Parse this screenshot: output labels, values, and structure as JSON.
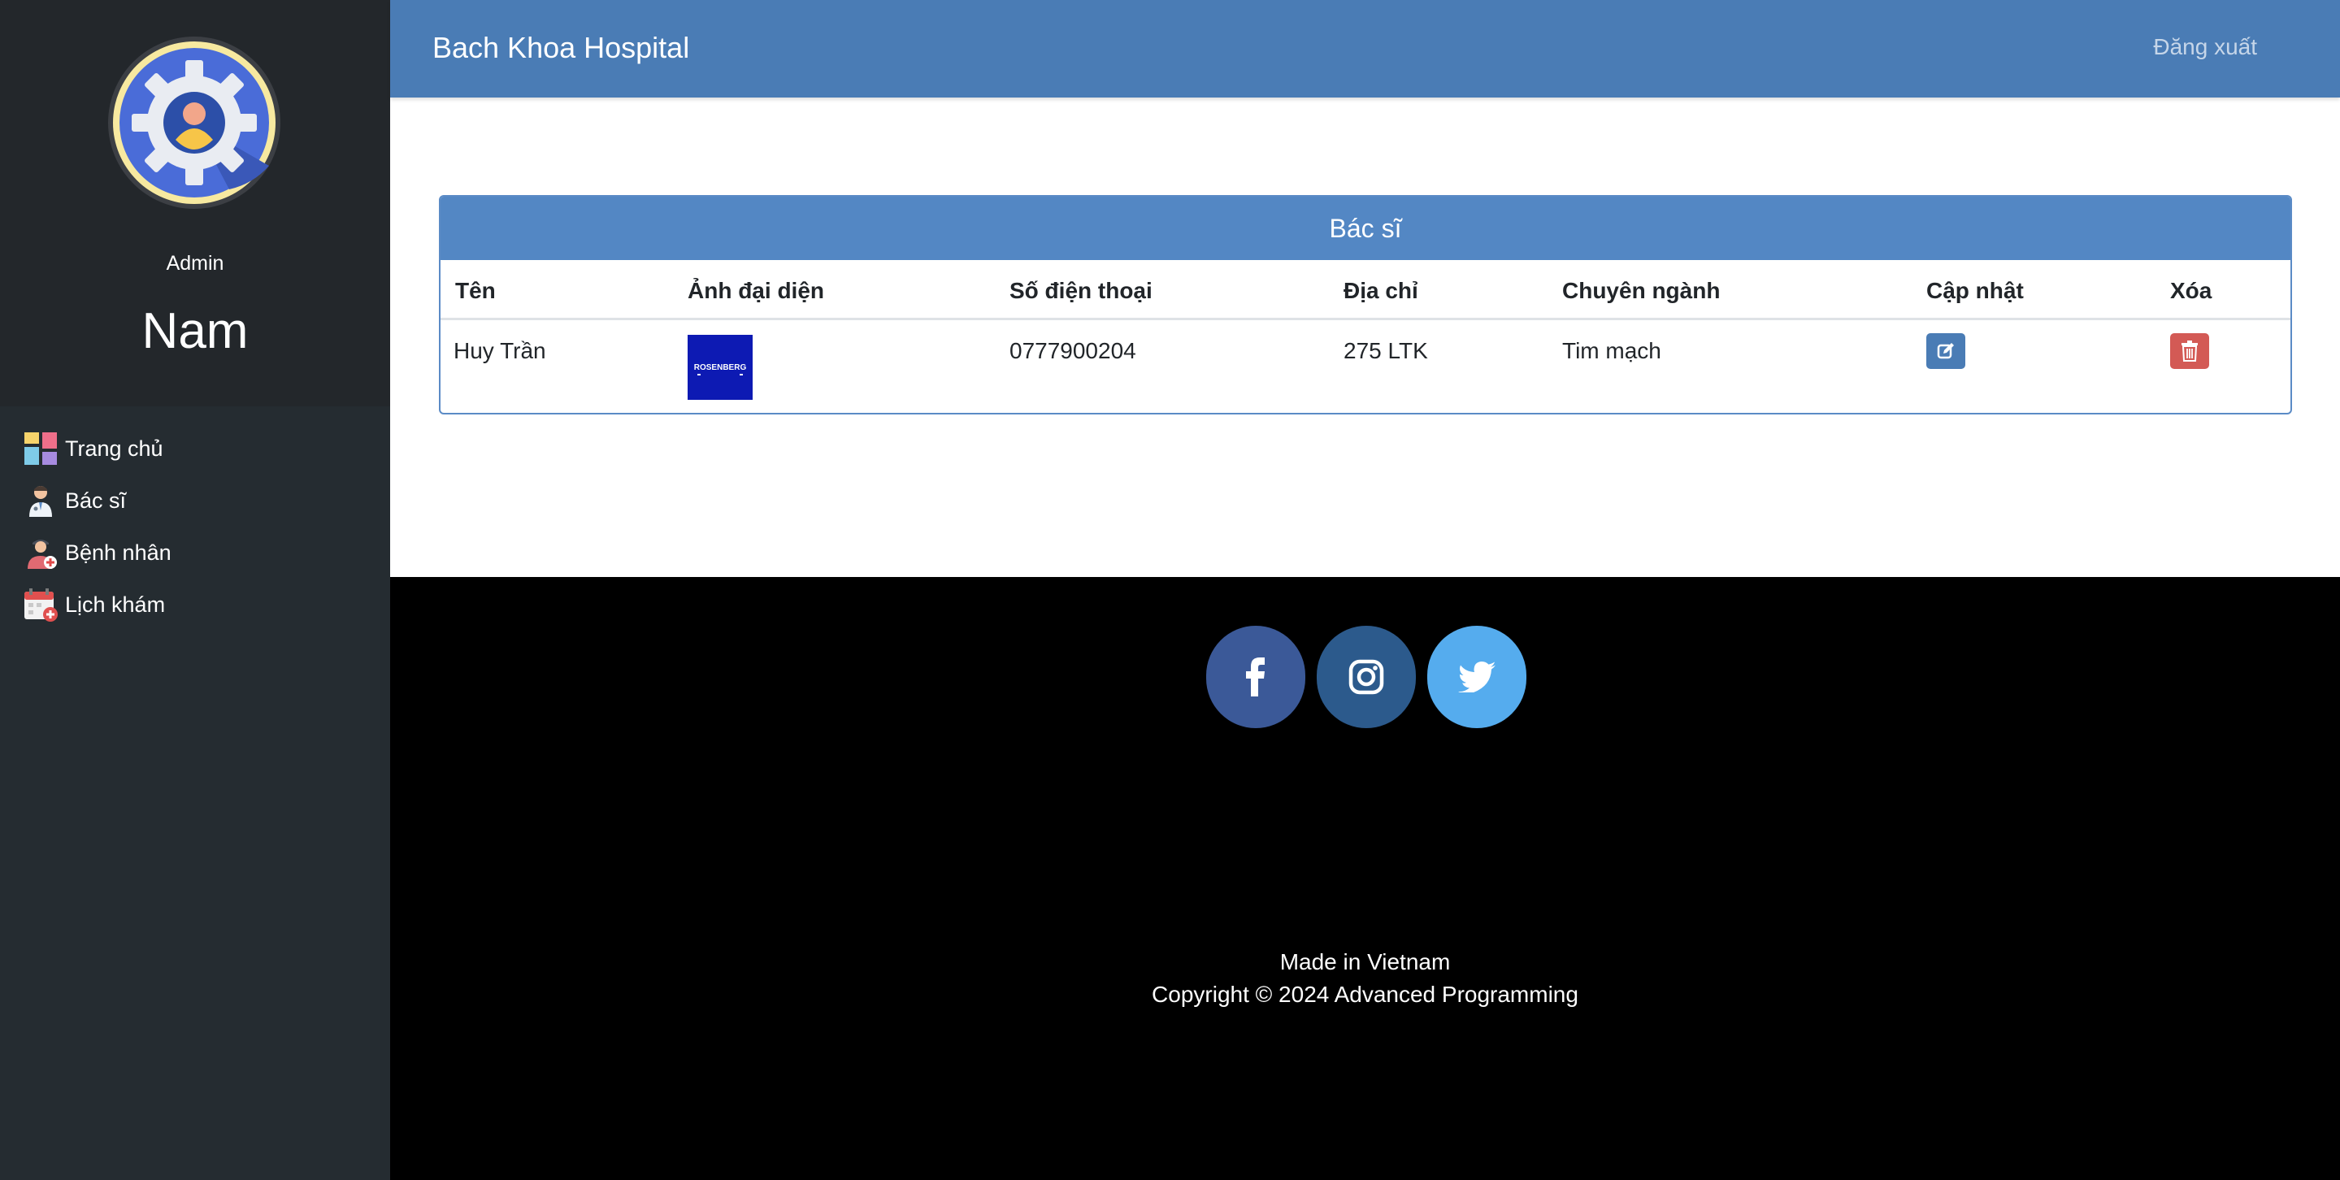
{
  "sidebar": {
    "role": "Admin",
    "user_name": "Nam",
    "items": [
      {
        "label": "Trang chủ",
        "icon": "dashboard-icon"
      },
      {
        "label": "Bác sĩ",
        "icon": "doctor-icon"
      },
      {
        "label": "Bệnh nhân",
        "icon": "patient-icon"
      },
      {
        "label": "Lịch khám",
        "icon": "calendar-icon"
      }
    ]
  },
  "header": {
    "brand": "Bach Khoa Hospital",
    "logout": "Đăng xuất"
  },
  "table": {
    "title": "Bác sĩ",
    "columns": [
      "Tên",
      "Ảnh đại diện",
      "Số điện thoại",
      "Địa chỉ",
      "Chuyên ngành",
      "Cập nhật",
      "Xóa"
    ],
    "rows": [
      {
        "name": "Huy Trần",
        "avatar_text": "ROSENBERG",
        "phone": "0777900204",
        "address": "275 LTK",
        "specialty": "Tim mạch"
      }
    ]
  },
  "footer": {
    "social": [
      "facebook-icon",
      "instagram-icon",
      "twitter-icon"
    ],
    "made_in": "Made in Vietnam",
    "copyright": "Copyright © 2024 Advanced Programming"
  },
  "colors": {
    "sidebar": "#252c31",
    "header": "#4a7cb5",
    "card_title": "#5387c4",
    "edit": "#4a7cb5",
    "delete": "#d35a55",
    "facebook": "#3b5998",
    "instagram": "#2c5a8c",
    "twitter": "#55acee"
  }
}
